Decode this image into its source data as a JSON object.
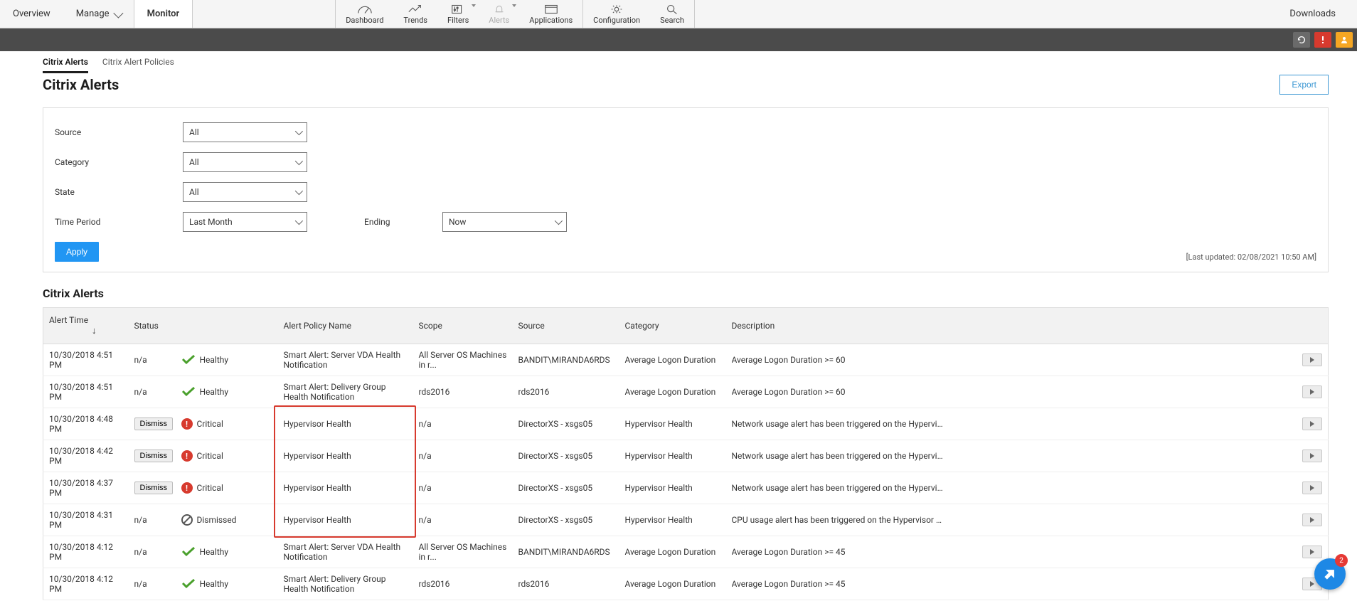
{
  "topnav": {
    "overview": "Overview",
    "manage": "Manage",
    "monitor": "Monitor",
    "downloads": "Downloads"
  },
  "toolbar": {
    "dashboard": "Dashboard",
    "trends": "Trends",
    "filters": "Filters",
    "alerts": "Alerts",
    "applications": "Applications",
    "configuration": "Configuration",
    "search": "Search"
  },
  "subtabs": {
    "citrix_alerts": "Citrix Alerts",
    "citrix_alert_policies": "Citrix Alert Policies"
  },
  "page": {
    "title": "Citrix Alerts",
    "section_title": "Citrix Alerts",
    "export": "Export",
    "last_updated": "[Last updated: 02/08/2021 10:50 AM]"
  },
  "filters": {
    "source_label": "Source",
    "source_value": "All",
    "category_label": "Category",
    "category_value": "All",
    "state_label": "State",
    "state_value": "All",
    "timeperiod_label": "Time Period",
    "timeperiod_value": "Last Month",
    "ending_label": "Ending",
    "ending_value": "Now",
    "apply": "Apply"
  },
  "columns": {
    "alert_time": "Alert Time",
    "status": "Status",
    "policy": "Alert Policy Name",
    "scope": "Scope",
    "source": "Source",
    "category": "Category",
    "description": "Description"
  },
  "labels": {
    "dismiss": "Dismiss",
    "na": "n/a",
    "healthy": "Healthy",
    "critical": "Critical",
    "dismissed": "Dismissed"
  },
  "rows": [
    {
      "time": "10/30/2018 4:51 PM",
      "dismiss": "na",
      "status": "healthy",
      "policy": "Smart Alert: Server VDA Health Notification",
      "scope": "All Server OS Machines in r...",
      "source": "BANDIT\\MIRANDA6RDS",
      "category": "Average Logon Duration",
      "description": "Average Logon Duration >= 60"
    },
    {
      "time": "10/30/2018 4:51 PM",
      "dismiss": "na",
      "status": "healthy",
      "policy": "Smart Alert: Delivery Group Health Notification",
      "scope": "rds2016",
      "source": "rds2016",
      "category": "Average Logon Duration",
      "description": "Average Logon Duration >= 60"
    },
    {
      "time": "10/30/2018 4:48 PM",
      "dismiss": "btn",
      "status": "critical",
      "policy": "Hypervisor Health",
      "scope": "n/a",
      "source": "DirectorXS - xsgs05",
      "category": "Hypervisor Health",
      "description": "Network usage alert has been triggered on the Hypervisor host. For det..."
    },
    {
      "time": "10/30/2018 4:42 PM",
      "dismiss": "btn",
      "status": "critical",
      "policy": "Hypervisor Health",
      "scope": "n/a",
      "source": "DirectorXS - xsgs05",
      "category": "Hypervisor Health",
      "description": "Network usage alert has been triggered on the Hypervisor host. For det..."
    },
    {
      "time": "10/30/2018 4:37 PM",
      "dismiss": "btn",
      "status": "critical",
      "policy": "Hypervisor Health",
      "scope": "n/a",
      "source": "DirectorXS - xsgs05",
      "category": "Hypervisor Health",
      "description": "Network usage alert has been triggered on the Hypervisor host. For det..."
    },
    {
      "time": "10/30/2018 4:31 PM",
      "dismiss": "na",
      "status": "dismissed",
      "policy": "Hypervisor Health",
      "scope": "n/a",
      "source": "DirectorXS - xsgs05",
      "category": "Hypervisor Health",
      "description": "CPU usage alert has been triggered on the Hypervisor host. For details c..."
    },
    {
      "time": "10/30/2018 4:12 PM",
      "dismiss": "na",
      "status": "healthy",
      "policy": "Smart Alert: Server VDA Health Notification",
      "scope": "All Server OS Machines in r...",
      "source": "BANDIT\\MIRANDA6RDS",
      "category": "Average Logon Duration",
      "description": "Average Logon Duration >= 45"
    },
    {
      "time": "10/30/2018 4:12 PM",
      "dismiss": "na",
      "status": "healthy",
      "policy": "Smart Alert: Delivery Group Health Notification",
      "scope": "rds2016",
      "source": "rds2016",
      "category": "Average Logon Duration",
      "description": "Average Logon Duration >= 45"
    }
  ],
  "fab": {
    "badge": "2"
  }
}
